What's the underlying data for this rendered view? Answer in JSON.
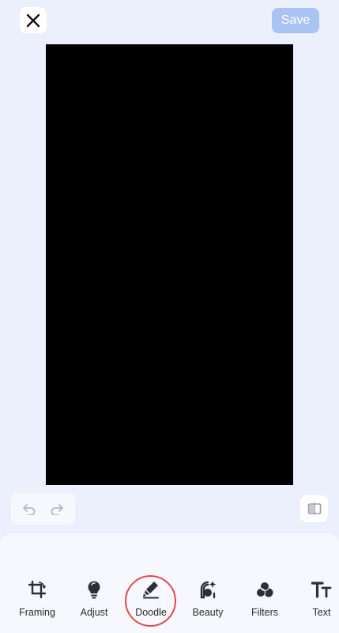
{
  "topbar": {
    "close_icon": "close-icon",
    "save_label": "Save",
    "save_color": "#a9c3f3"
  },
  "canvas": {
    "background": "#000000"
  },
  "history": {
    "undo_icon": "undo-icon",
    "redo_icon": "redo-icon"
  },
  "compare": {
    "icon": "compare-icon"
  },
  "toolbar": {
    "items": [
      {
        "label": "Framing",
        "icon": "crop-rotate-icon"
      },
      {
        "label": "Adjust",
        "icon": "lightbulb-icon"
      },
      {
        "label": "Doodle",
        "icon": "marker-pen-icon",
        "highlighted": true
      },
      {
        "label": "Beauty",
        "icon": "face-sparkle-icon"
      },
      {
        "label": "Filters",
        "icon": "filters-icon"
      },
      {
        "label": "Text",
        "icon": "text-icon"
      }
    ]
  },
  "highlight_color": "#e04a4a"
}
